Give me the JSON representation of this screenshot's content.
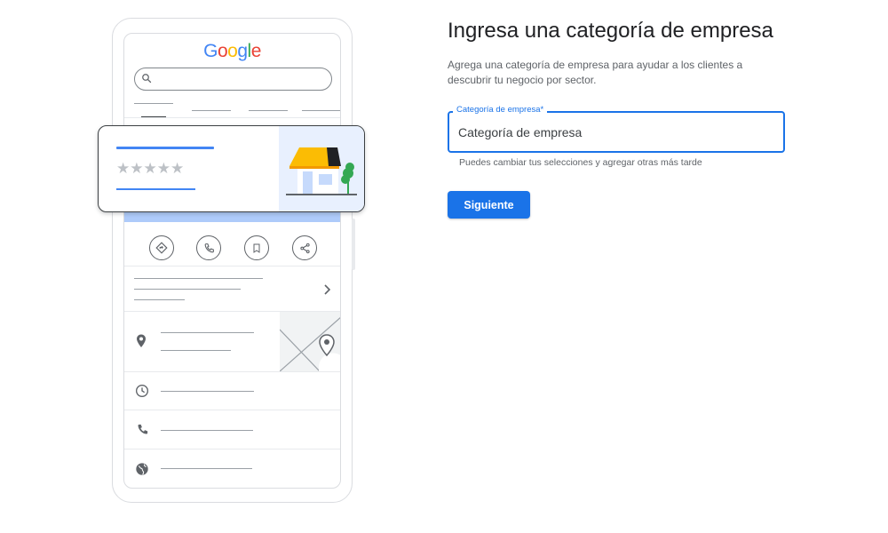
{
  "illustration": {
    "logo": {
      "text": "Google",
      "letter_colors": [
        "#4285F4",
        "#EA4335",
        "#FBBC05",
        "#4285F4",
        "#34A853",
        "#EA4335"
      ]
    },
    "rating_stars": 5,
    "icons": {
      "search": "search-icon",
      "actions": [
        "directions-icon",
        "phone-icon",
        "bookmark-icon",
        "share-icon"
      ],
      "rows": [
        "location-pin-icon",
        "clock-icon",
        "phone-icon",
        "globe-icon"
      ],
      "chevron": "chevron-right-icon"
    }
  },
  "form": {
    "title": "Ingresa una categoría de empresa",
    "subtitle": "Agrega una categoría de empresa para ayudar a los clientes a descubrir tu negocio por sector.",
    "category_field": {
      "label": "Categoría de empresa*",
      "placeholder": "Categoría de empresa",
      "value": ""
    },
    "helper_text": "Puedes cambiar tus selecciones y agregar otras más tarde",
    "next_button_label": "Siguiente"
  },
  "colors": {
    "primary": "#1a73e8",
    "awning": "#fbbc04",
    "tree": "#34a853"
  }
}
